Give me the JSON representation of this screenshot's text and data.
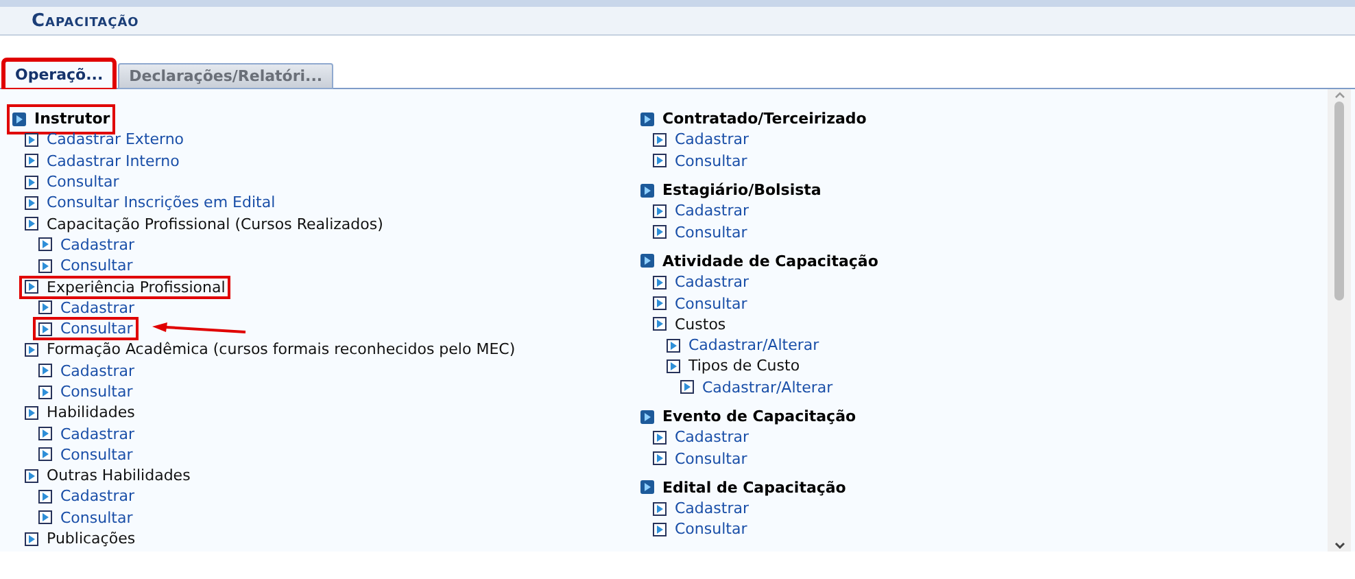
{
  "header": {
    "title": "Capacitação"
  },
  "tabs": [
    {
      "label": "Operaçõ...",
      "selected": true,
      "highlighted": true
    },
    {
      "label": "Declarações/Relatóri...",
      "selected": false,
      "highlighted": false
    }
  ],
  "columns": [
    [
      {
        "title": "Instrutor",
        "highlighted": true,
        "children": [
          {
            "label": "Cadastrar Externo",
            "kind": "link",
            "highlighted": false,
            "arrow": false
          },
          {
            "label": "Cadastrar Interno",
            "kind": "link",
            "highlighted": false,
            "arrow": false
          },
          {
            "label": "Consultar",
            "kind": "link",
            "highlighted": false,
            "arrow": false
          },
          {
            "label": "Consultar Inscrições em Edital",
            "kind": "link",
            "highlighted": false,
            "arrow": false
          },
          {
            "label": "Capacitação Profissional (Cursos Realizados)",
            "kind": "label",
            "highlighted": false,
            "arrow": false,
            "children": [
              {
                "label": "Cadastrar",
                "kind": "link",
                "highlighted": false,
                "arrow": false
              },
              {
                "label": "Consultar",
                "kind": "link",
                "highlighted": false,
                "arrow": false
              }
            ]
          },
          {
            "label": "Experiência Profissional",
            "kind": "label",
            "highlighted": true,
            "arrow": false,
            "children": [
              {
                "label": "Cadastrar",
                "kind": "link",
                "highlighted": false,
                "arrow": false
              },
              {
                "label": "Consultar",
                "kind": "link",
                "highlighted": true,
                "arrow": true
              }
            ]
          },
          {
            "label": "Formação Acadêmica (cursos formais reconhecidos pelo MEC)",
            "kind": "label",
            "highlighted": false,
            "arrow": false,
            "children": [
              {
                "label": "Cadastrar",
                "kind": "link",
                "highlighted": false,
                "arrow": false
              },
              {
                "label": "Consultar",
                "kind": "link",
                "highlighted": false,
                "arrow": false
              }
            ]
          },
          {
            "label": "Habilidades",
            "kind": "label",
            "highlighted": false,
            "arrow": false,
            "children": [
              {
                "label": "Cadastrar",
                "kind": "link",
                "highlighted": false,
                "arrow": false
              },
              {
                "label": "Consultar",
                "kind": "link",
                "highlighted": false,
                "arrow": false
              }
            ]
          },
          {
            "label": "Outras Habilidades",
            "kind": "label",
            "highlighted": false,
            "arrow": false,
            "children": [
              {
                "label": "Cadastrar",
                "kind": "link",
                "highlighted": false,
                "arrow": false
              },
              {
                "label": "Consultar",
                "kind": "link",
                "highlighted": false,
                "arrow": false
              }
            ]
          },
          {
            "label": "Publicações",
            "kind": "label",
            "highlighted": false,
            "arrow": false
          }
        ]
      }
    ],
    [
      {
        "title": "Contratado/Terceirizado",
        "highlighted": false,
        "children": [
          {
            "label": "Cadastrar",
            "kind": "link",
            "highlighted": false,
            "arrow": false
          },
          {
            "label": "Consultar",
            "kind": "link",
            "highlighted": false,
            "arrow": false
          }
        ]
      },
      {
        "title": "Estagiário/Bolsista",
        "highlighted": false,
        "children": [
          {
            "label": "Cadastrar",
            "kind": "link",
            "highlighted": false,
            "arrow": false
          },
          {
            "label": "Consultar",
            "kind": "link",
            "highlighted": false,
            "arrow": false
          }
        ]
      },
      {
        "title": "Atividade de Capacitação",
        "highlighted": false,
        "children": [
          {
            "label": "Cadastrar",
            "kind": "link",
            "highlighted": false,
            "arrow": false
          },
          {
            "label": "Consultar",
            "kind": "link",
            "highlighted": false,
            "arrow": false
          },
          {
            "label": "Custos",
            "kind": "label",
            "highlighted": false,
            "arrow": false,
            "children": [
              {
                "label": "Cadastrar/Alterar",
                "kind": "link",
                "highlighted": false,
                "arrow": false
              },
              {
                "label": "Tipos de Custo",
                "kind": "label",
                "highlighted": false,
                "arrow": false,
                "children": [
                  {
                    "label": "Cadastrar/Alterar",
                    "kind": "link",
                    "highlighted": false,
                    "arrow": false
                  }
                ]
              }
            ]
          }
        ]
      },
      {
        "title": "Evento de Capacitação",
        "highlighted": false,
        "children": [
          {
            "label": "Cadastrar",
            "kind": "link",
            "highlighted": false,
            "arrow": false
          },
          {
            "label": "Consultar",
            "kind": "link",
            "highlighted": false,
            "arrow": false
          }
        ]
      },
      {
        "title": "Edital de Capacitação",
        "highlighted": false,
        "children": [
          {
            "label": "Cadastrar",
            "kind": "link",
            "highlighted": false,
            "arrow": false
          },
          {
            "label": "Consultar",
            "kind": "link",
            "highlighted": false,
            "arrow": false
          }
        ]
      }
    ]
  ]
}
